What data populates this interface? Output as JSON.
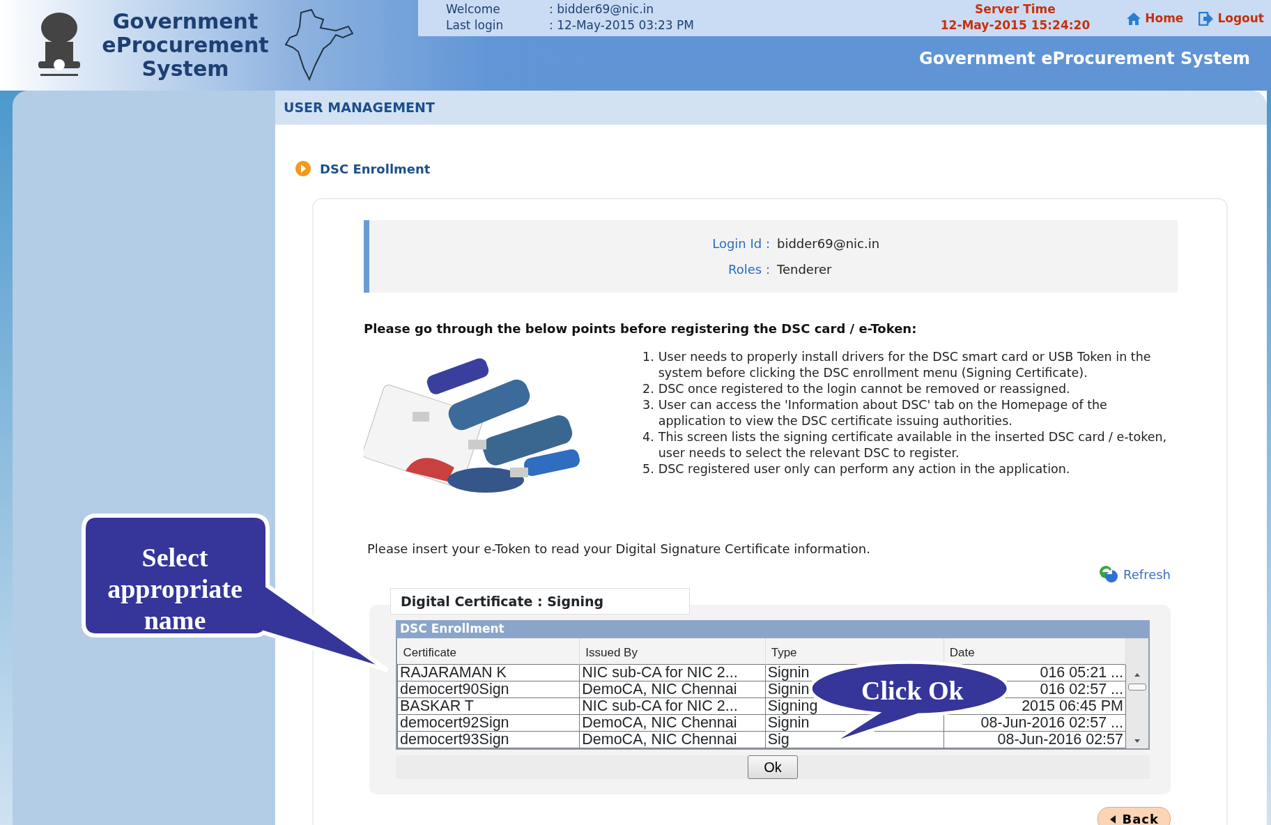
{
  "header": {
    "title": "Government eProcurement System",
    "welcome_label": "Welcome",
    "welcome_value": ": bidder69@nic.in",
    "last_login_label": "Last login",
    "last_login_value": ": 12-May-2015 03:23 PM",
    "server_time_label": "Server Time",
    "server_time_value": "12-May-2015 15:24:20",
    "links": [
      {
        "kind": "home",
        "label": "Home"
      },
      {
        "kind": "logout",
        "label": "Logout"
      }
    ],
    "banner": "Government eProcurement System"
  },
  "section_title": "USER MANAGEMENT",
  "page_title": "DSC Enrollment",
  "info": [
    {
      "label": "Login Id :",
      "value": "bidder69@nic.in"
    },
    {
      "label": "Roles :",
      "value": "Tenderer"
    }
  ],
  "instructions_heading": "Please go through the below points before registering the DSC card / e-Token:",
  "points": [
    {
      "number": "1.",
      "text": "User needs to properly install drivers for the DSC smart card or USB Token in the system before clicking the DSC enrollment menu (Signing Certificate)."
    },
    {
      "number": "2.",
      "text": "DSC once registered to the login cannot be removed or reassigned."
    },
    {
      "number": "3.",
      "text": "User can access the 'Information about DSC' tab on the Homepage of the application to view the DSC certificate issuing authorities."
    },
    {
      "number": "4.",
      "text": "This screen lists the signing certificate available in the inserted DSC card / e-token, user needs to select the relevant DSC to register."
    },
    {
      "number": "5.",
      "text": "DSC registered user only can perform any action in the application."
    }
  ],
  "insert_message": "Please insert your e-Token to read your Digital Signature Certificate information.",
  "refresh": "Refresh",
  "tab": "Digital Certificate : Signing",
  "table": {
    "caption": "DSC Enrollment",
    "columns": [
      "Certificate",
      "Issued By",
      "Type",
      "Date"
    ],
    "rows": [
      [
        "RAJARAMAN K",
        "NIC sub-CA for NIC 2...",
        "Signin",
        "016 05:21 ..."
      ],
      [
        "democert90Sign",
        "DemoCA, NIC Chennai",
        "Signin",
        "016 02:57 ..."
      ],
      [
        "BASKAR T",
        "NIC sub-CA for NIC 2...",
        "Signing",
        "2015 06:45 PM"
      ],
      [
        "democert92Sign",
        "DemoCA, NIC Chennai",
        "Signin",
        "08-Jun-2016 02:57 ..."
      ],
      [
        "democert93Sign",
        "DemoCA, NIC Chennai",
        "Sig",
        "08-Jun-2016 02:57"
      ]
    ]
  },
  "ok_button": "Ok",
  "back_button": "Back",
  "callouts": [
    {
      "kind": "box",
      "text": "Select appropriate name"
    },
    {
      "kind": "oval",
      "text": "Click Ok"
    }
  ]
}
